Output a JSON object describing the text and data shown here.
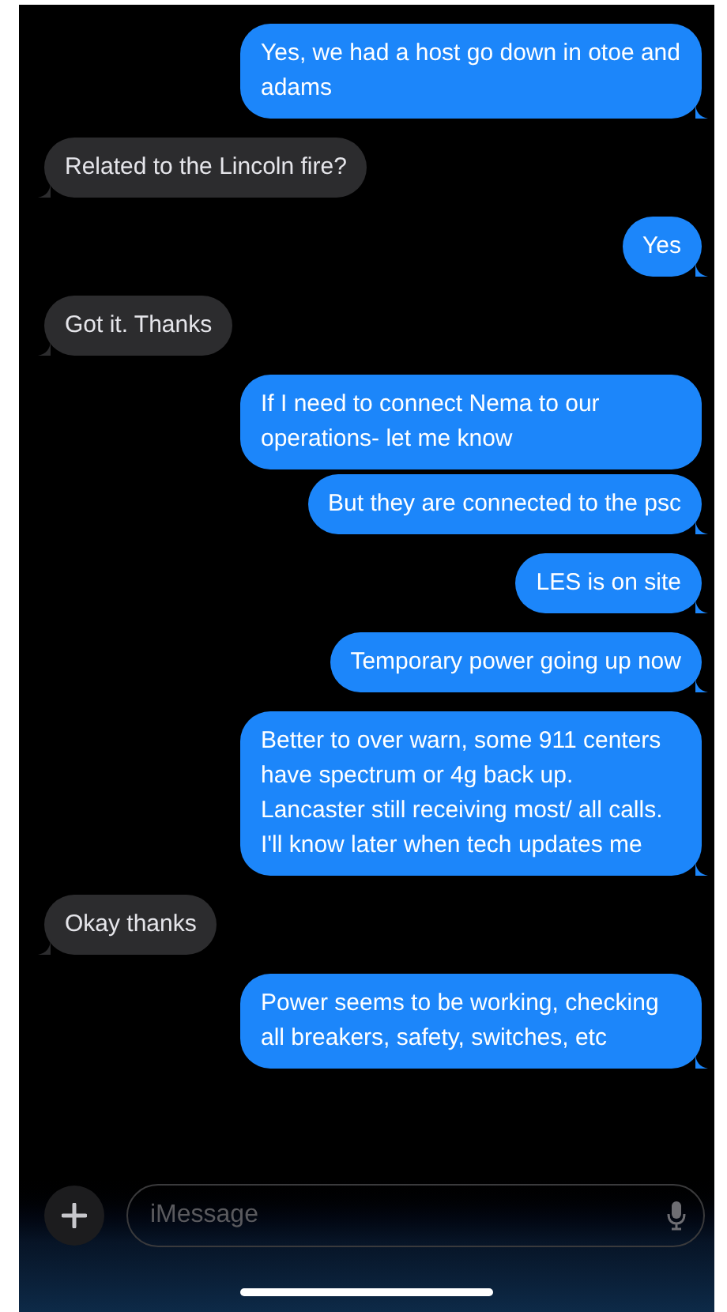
{
  "messages": [
    {
      "kind": "sent",
      "text": "Yes, we had a host go down in otoe and adams",
      "tail": true
    },
    {
      "kind": "received",
      "text": "Related to the Lincoln fire?",
      "tail": true
    },
    {
      "kind": "sent",
      "text": "Yes",
      "tail": true
    },
    {
      "kind": "received",
      "text": "Got it. Thanks",
      "tail": true
    },
    {
      "kind": "sent",
      "text": "If I need to connect Nema to our operations- let me know",
      "tail": false
    },
    {
      "kind": "sent",
      "text": "But they are connected to the psc",
      "tail": true
    },
    {
      "kind": "sent",
      "text": "LES is on site",
      "tail": true
    },
    {
      "kind": "sent",
      "text": "Temporary power going up now",
      "tail": true
    },
    {
      "kind": "sent",
      "text": "Better to over warn, some 911 centers have spectrum or 4g back up. Lancaster still receiving most/ all calls. I'll know later when tech updates me",
      "tail": true
    },
    {
      "kind": "received",
      "text": "Okay thanks",
      "tail": true
    },
    {
      "kind": "sent",
      "text": "Power seems to be working, checking all breakers, safety, switches, etc",
      "tail": true
    }
  ],
  "composer": {
    "placeholder": "iMessage"
  }
}
